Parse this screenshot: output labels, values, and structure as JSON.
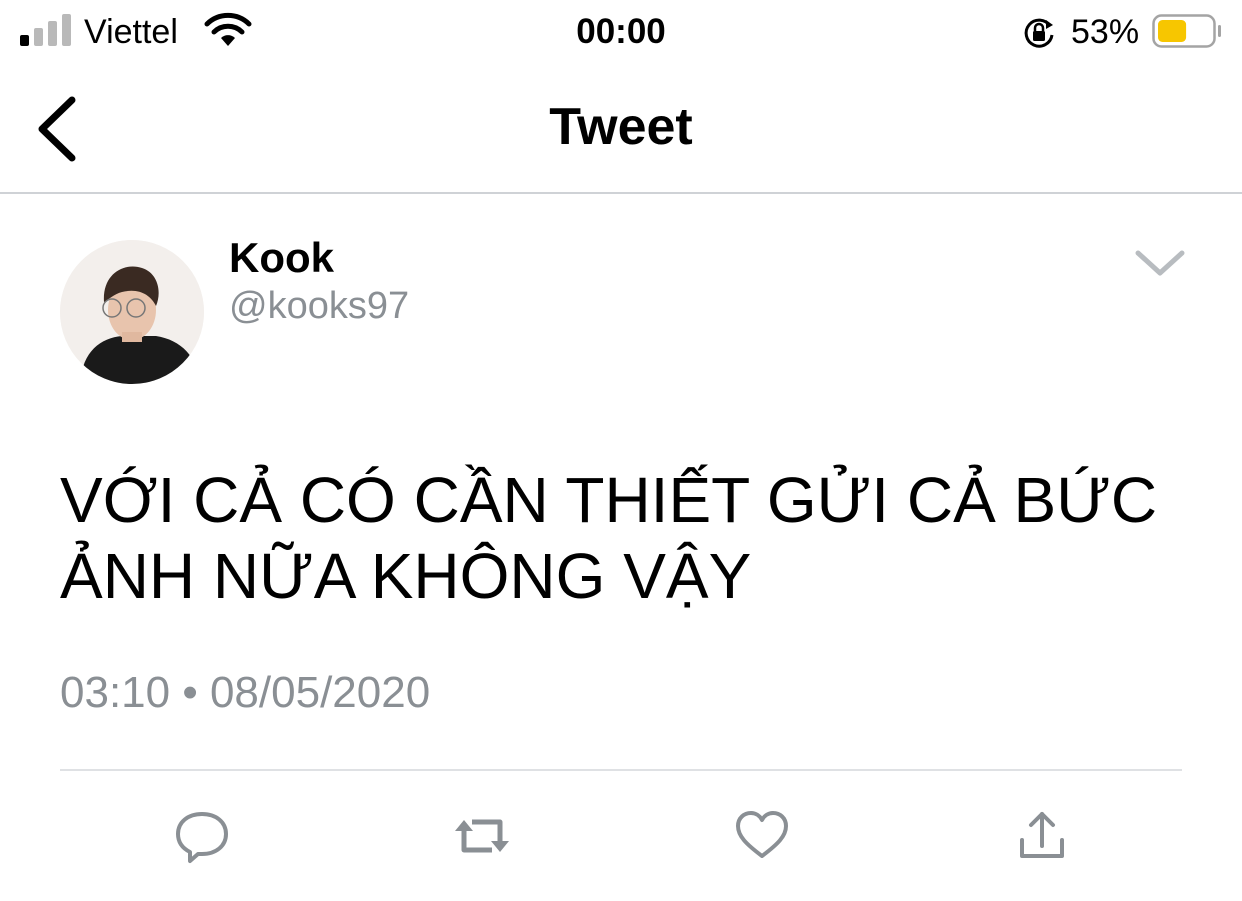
{
  "status_bar": {
    "carrier": "Viettel",
    "time": "00:00",
    "battery_percent": "53%",
    "battery_level": 0.53,
    "signal_bars_active": 1,
    "battery_color": "#f7c600"
  },
  "nav": {
    "title": "Tweet",
    "back_icon": "chevron-left-icon"
  },
  "tweet": {
    "author_name": "Kook",
    "author_handle": "@kooks97",
    "text": "VỚI CẢ CÓ CẦN THIẾT GỬI CẢ BỨC ẢNH NỮA KHÔNG VẬY",
    "timestamp": "03:10 • 08/05/2020",
    "menu_icon": "chevron-down-icon"
  },
  "actions": [
    {
      "name": "reply",
      "icon": "reply-icon"
    },
    {
      "name": "retweet",
      "icon": "retweet-icon"
    },
    {
      "name": "like",
      "icon": "heart-icon"
    },
    {
      "name": "share",
      "icon": "share-icon"
    }
  ],
  "colors": {
    "text": "#000000",
    "muted": "#8a8f94",
    "icon": "#8a8f94"
  }
}
